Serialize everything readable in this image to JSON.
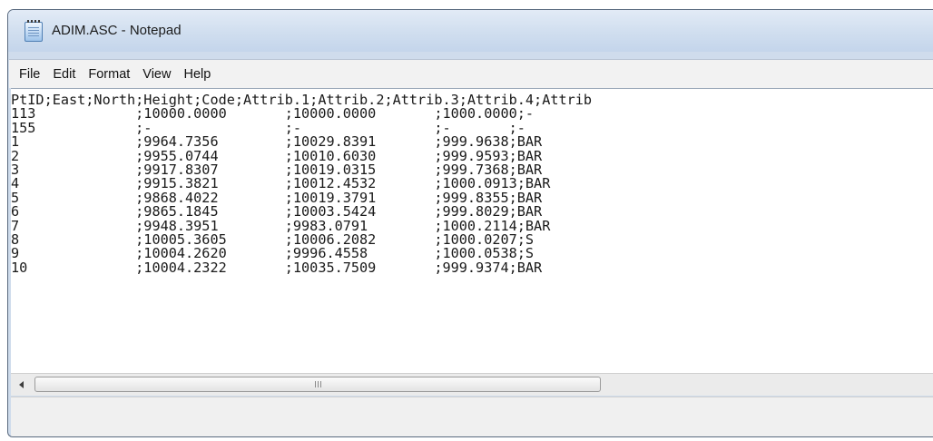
{
  "window": {
    "title": "ADIM.ASC - Notepad"
  },
  "menu": {
    "items": [
      "File",
      "Edit",
      "Format",
      "View",
      "Help"
    ]
  },
  "editor": {
    "lines": [
      "PtID;East;North;Height;Code;Attrib.1;Attrib.2;Attrib.3;Attrib.4;Attrib",
      "113            ;10000.0000       ;10000.0000       ;1000.0000;-",
      "155            ;-                ;-                ;-       ;-",
      "1              ;9964.7356        ;10029.8391       ;999.9638;BAR",
      "2              ;9955.0744        ;10010.6030       ;999.9593;BAR",
      "3              ;9917.8307        ;10019.0315       ;999.7368;BAR",
      "4              ;9915.3821        ;10012.4532       ;1000.0913;BAR",
      "5              ;9868.4022        ;10019.3791       ;999.8355;BAR",
      "6              ;9865.1845        ;10003.5424       ;999.8029;BAR",
      "7              ;9948.3951        ;9983.0791        ;1000.2114;BAR",
      "8              ;10005.3605       ;10006.2082       ;1000.0207;S",
      "9              ;10004.2620       ;9996.4558        ;1000.0538;S",
      "10             ;10004.2322       ;10035.7509       ;999.9374;BAR"
    ]
  },
  "scrollbar": {
    "grip_glyph": "III"
  }
}
